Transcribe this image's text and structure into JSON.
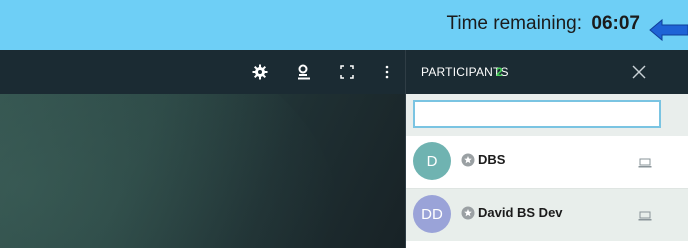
{
  "banner": {
    "time_label": "Time remaining:",
    "time_value": "06:07",
    "background": "#6ecff6",
    "arrow_color": "#1e63d6"
  },
  "toolbar": {
    "icons": [
      "gear-icon",
      "webcam-icon",
      "fullscreen-icon",
      "more-vertical-icon"
    ]
  },
  "participants": {
    "title": "PARTICIPANTS",
    "count": "2",
    "count_color": "#47d15a",
    "search": {
      "value": "",
      "placeholder": ""
    },
    "list": [
      {
        "initials": "D",
        "name": "DBS",
        "avatar_color": "#6fb3b1"
      },
      {
        "initials": "DD",
        "name": "David BS Dev",
        "avatar_color": "#9aa3d8"
      }
    ]
  }
}
